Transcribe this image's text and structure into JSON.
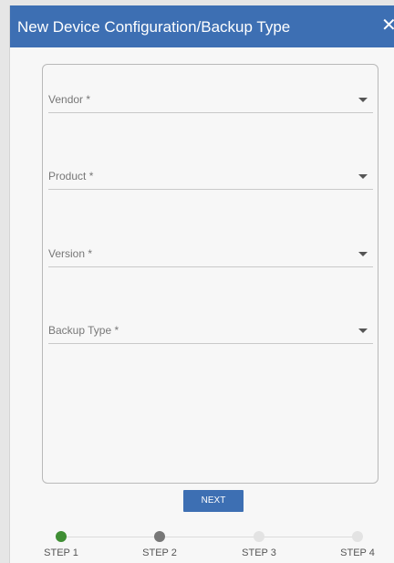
{
  "dialog": {
    "title": "New Device Configuration/Backup Type",
    "close_glyph": "✕",
    "close_icon": "close-icon",
    "title_bar_color": "#3d6fb3"
  },
  "form": {
    "fields": [
      {
        "label": "Vendor *",
        "value": "",
        "icon": "chevron-down-icon"
      },
      {
        "label": "Product *",
        "value": "",
        "icon": "chevron-down-icon"
      },
      {
        "label": "Version *",
        "value": "",
        "icon": "chevron-down-icon"
      },
      {
        "label": "Backup Type *",
        "value": "",
        "icon": "chevron-down-icon"
      }
    ]
  },
  "actions": {
    "next_label": "NEXT",
    "button_color": "#3d6fb3"
  },
  "stepper": {
    "steps": [
      {
        "label": "STEP 1",
        "state": "complete",
        "color": "#3f8e34"
      },
      {
        "label": "STEP 2",
        "state": "active",
        "color": "#777777"
      },
      {
        "label": "STEP 3",
        "state": "pending",
        "color": "#e3e3e3"
      },
      {
        "label": "STEP 4",
        "state": "pending",
        "color": "#e3e3e3"
      }
    ]
  }
}
